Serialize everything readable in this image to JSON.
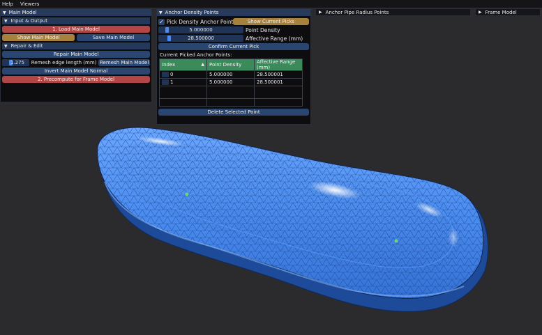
{
  "menubar": {
    "items": [
      "Help",
      "Viewers"
    ]
  },
  "main_model": {
    "title": "Main Model",
    "input_output": {
      "title": "Input & Output",
      "load_label": "1. Load Main Model",
      "show_label": "Show Main Model",
      "save_label": "Save Main Model"
    },
    "repair_edit": {
      "title": "Repair & Edit",
      "repair_label": "Repair Main Model",
      "edge_length_value": "1.275",
      "edge_length_label": "Remesh edge length (mm)",
      "remesh_label": "Remesh Main Model",
      "invert_label": "Invert Main Model Normal",
      "precompute_label": "2. Precompute for Frame Model"
    }
  },
  "anchor_density": {
    "title": "Anchor Density Points",
    "pick_checked": true,
    "pick_label": "Pick Density Anchor Points",
    "show_picks_label": "Show Current Picks",
    "point_density_value": "5.000000",
    "point_density_label": "Point Density",
    "affective_range_value": "28.500000",
    "affective_range_label": "Affective Range (mm)",
    "confirm_label": "Confirm Current Pick",
    "list_heading": "Current Picked Anchor Points:",
    "table": {
      "headers": [
        "Index",
        "Point Density",
        "Affective Range (mm)"
      ],
      "sort_indicator": "▲",
      "rows": [
        {
          "index": "0",
          "density": "5.000000",
          "range": "28.500001"
        },
        {
          "index": "1",
          "density": "5.000000",
          "range": "28.500001"
        }
      ]
    },
    "delete_label": "Delete Selected Point"
  },
  "anchor_pipe": {
    "title": "Anchor Pipe Radius Points"
  },
  "frame_model": {
    "title": "Frame Model"
  },
  "colors": {
    "background": "#2b2b2d",
    "mesh_fill": "#4a8df0",
    "header_blue": "#283a5c",
    "button_red": "#b24545",
    "button_gold": "#a5813d",
    "table_header_green": "#3a8a5a"
  }
}
